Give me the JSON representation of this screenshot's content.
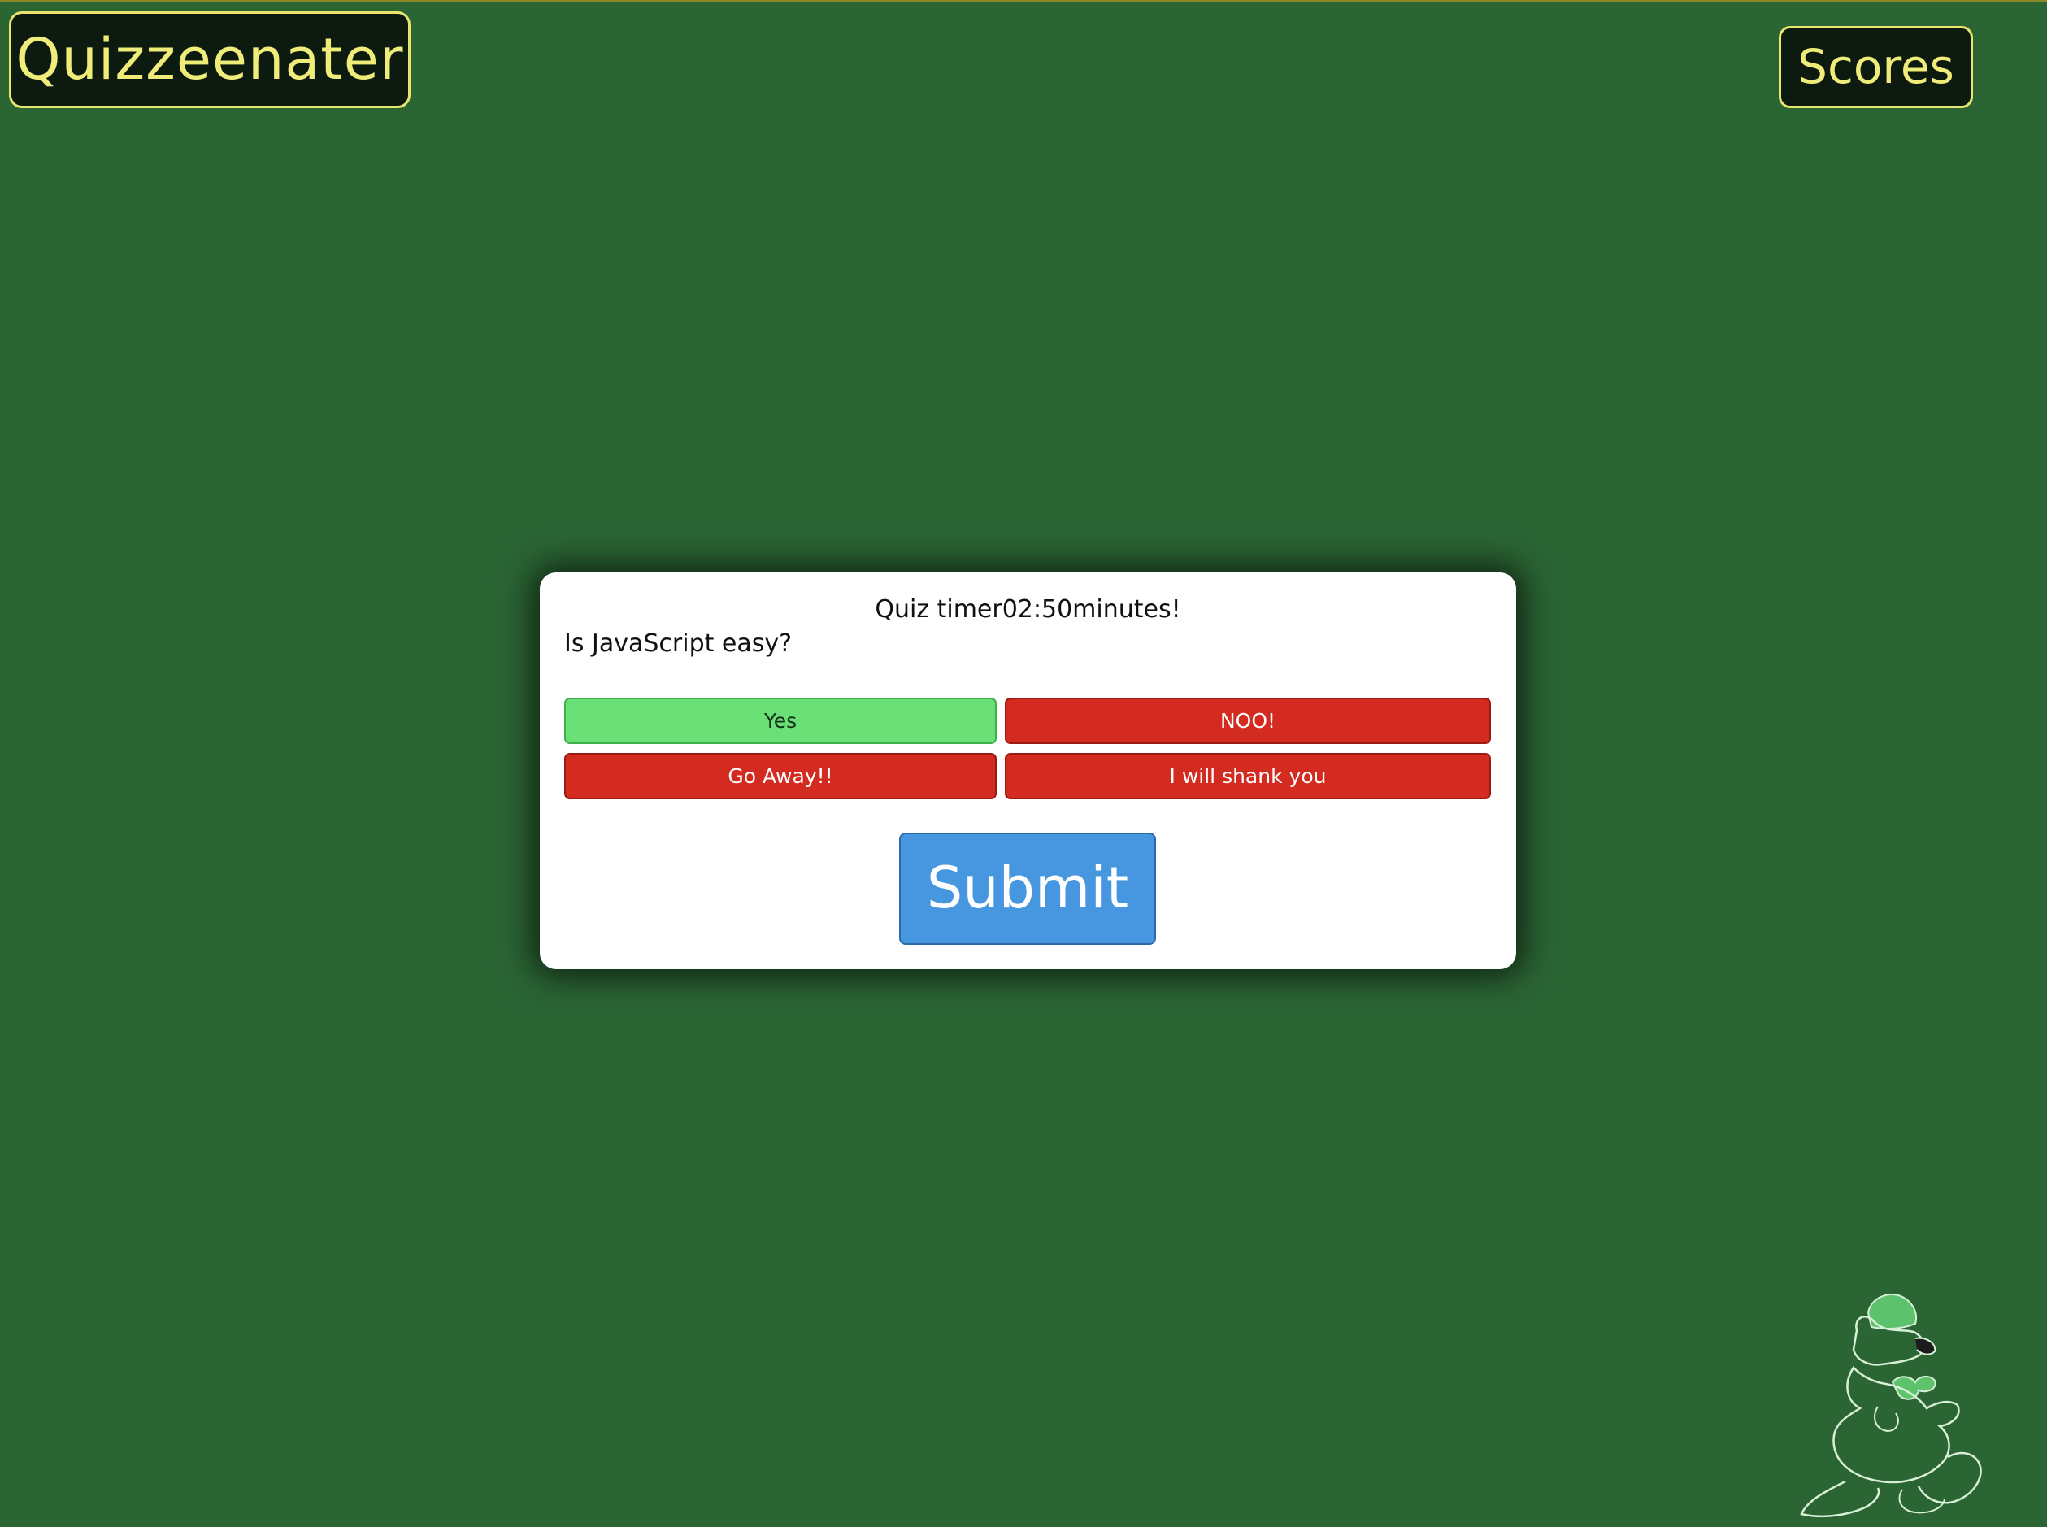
{
  "header": {
    "brand": "Quizzeenater",
    "scores_label": "Scores"
  },
  "quiz": {
    "timer_text": "Quiz timer02:50minutes!",
    "question": "Is JavaScript easy?",
    "answers": [
      {
        "label": "Yes",
        "state": "correct"
      },
      {
        "label": "NOO!",
        "state": "wrong"
      },
      {
        "label": "Go Away!!",
        "state": "wrong"
      },
      {
        "label": "I will shank you",
        "state": "wrong"
      }
    ],
    "submit_label": "Submit"
  },
  "colors": {
    "background": "#2b6534",
    "brand_text": "#f0ec7a",
    "correct": "#6ae076",
    "wrong": "#d32b20",
    "submit": "#4797e0"
  },
  "decor": {
    "mascot_icon": "duck-outline-icon"
  }
}
